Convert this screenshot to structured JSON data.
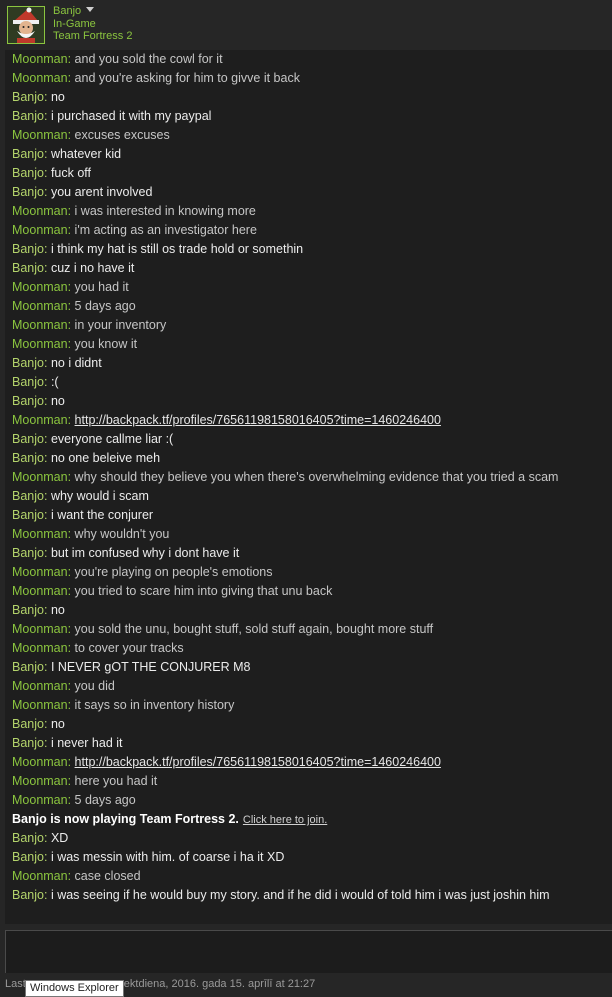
{
  "header": {
    "name": "Banjo",
    "status": "In-Game",
    "game": "Team Fortress 2"
  },
  "messages": [
    {
      "speaker": "Moonman",
      "text": "and you sold the cowl for it"
    },
    {
      "speaker": "Moonman",
      "text": "and you're asking for him to givve it back"
    },
    {
      "speaker": "Banjo",
      "text": "no"
    },
    {
      "speaker": "Banjo",
      "text": "i purchased it with my paypal"
    },
    {
      "speaker": "Moonman",
      "text": "excuses excuses"
    },
    {
      "speaker": "Banjo",
      "text": "whatever kid"
    },
    {
      "speaker": "Banjo",
      "text": "fuck off"
    },
    {
      "speaker": "Banjo",
      "text": "you arent involved"
    },
    {
      "speaker": "Moonman",
      "text": "i was interested in knowing more"
    },
    {
      "speaker": "Moonman",
      "text": "i'm acting as an investigator here"
    },
    {
      "speaker": "Banjo",
      "text": "i think my hat is still os trade hold or somethin"
    },
    {
      "speaker": "Banjo",
      "text": "cuz i no have it"
    },
    {
      "speaker": "Moonman",
      "text": "you had it"
    },
    {
      "speaker": "Moonman",
      "text": "5 days ago"
    },
    {
      "speaker": "Moonman",
      "text": "in your inventory"
    },
    {
      "speaker": "Moonman",
      "text": "you know it"
    },
    {
      "speaker": "Banjo",
      "text": "no i didnt"
    },
    {
      "speaker": "Banjo",
      "text": ":("
    },
    {
      "speaker": "Banjo",
      "text": "no"
    },
    {
      "speaker": "Moonman",
      "text": "http://backpack.tf/profiles/76561198158016405?time=1460246400",
      "link": true
    },
    {
      "speaker": "Banjo",
      "text": "everyone callme liar :("
    },
    {
      "speaker": "Banjo",
      "text": "no one beleive meh"
    },
    {
      "speaker": "Moonman",
      "text": "why should they believe you when there's overwhelming evidence that you tried a scam"
    },
    {
      "speaker": "Banjo",
      "text": "why would i scam"
    },
    {
      "speaker": "Banjo",
      "text": "i want the conjurer"
    },
    {
      "speaker": "Moonman",
      "text": "why wouldn't you"
    },
    {
      "speaker": "Banjo",
      "text": "but im confused why i dont have it"
    },
    {
      "speaker": "Moonman",
      "text": "you're playing on people's emotions"
    },
    {
      "speaker": "Moonman",
      "text": "you tried to scare him into giving that unu back"
    },
    {
      "speaker": "Banjo",
      "text": "no"
    },
    {
      "speaker": "Moonman",
      "text": "you sold the unu, bought stuff, sold stuff again, bought more stuff"
    },
    {
      "speaker": "Moonman",
      "text": "to cover your tracks"
    },
    {
      "speaker": "Banjo",
      "text": "I NEVER gOT THE CONJURER M8"
    },
    {
      "speaker": "Moonman",
      "text": "you did"
    },
    {
      "speaker": "Moonman",
      "text": "it says so in inventory history"
    },
    {
      "speaker": "Banjo",
      "text": "no"
    },
    {
      "speaker": "Banjo",
      "text": "i never had it"
    },
    {
      "speaker": "Moonman",
      "text": "http://backpack.tf/profiles/76561198158016405?time=1460246400",
      "link": true
    },
    {
      "speaker": "Moonman",
      "text": "here you had it"
    },
    {
      "speaker": "Moonman",
      "text": "5 days ago"
    },
    {
      "notice": "Banjo is now playing Team Fortress 2.",
      "notice_link": "Click here to join."
    },
    {
      "speaker": "Banjo",
      "text": "XD"
    },
    {
      "speaker": "Banjo",
      "text": "i was messin with him. of coarse i ha it XD"
    },
    {
      "speaker": "Moonman",
      "text": "case closed"
    },
    {
      "speaker": "Banjo",
      "text": "i was seeing if he would buy my story. and if he did i would of told him i was just joshin him"
    }
  ],
  "footer": {
    "prefix": "Last",
    "visible_text": "ektdiena, 2016. gada 15. aprīlī at 21:27"
  },
  "tooltip": "Windows Explorer",
  "colors": {
    "background": "#262626",
    "chat_background": "#1e1e1e",
    "banjo_name": "#b3d36b",
    "moonman_name": "#8bc53f"
  }
}
